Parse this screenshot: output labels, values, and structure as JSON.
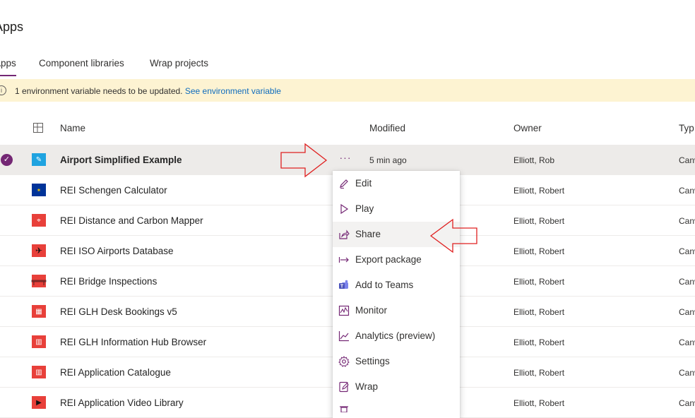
{
  "page": {
    "title": "Apps"
  },
  "tabs": [
    {
      "label": "Apps",
      "active": true
    },
    {
      "label": "Component libraries",
      "active": false
    },
    {
      "label": "Wrap projects",
      "active": false
    }
  ],
  "banner": {
    "message": "1 environment variable needs to be updated. ",
    "link": "See environment variable",
    "icon": "info-icon"
  },
  "table": {
    "headers": {
      "name": "Name",
      "modified": "Modified",
      "owner": "Owner",
      "type": "Typ"
    },
    "rows": [
      {
        "name": "Airport Simplified Example",
        "modified": "5 min ago",
        "owner": "Elliott, Rob",
        "type": "Canv",
        "icon": "pencil-icon",
        "icon_color": "#1fa3e0",
        "selected": true
      },
      {
        "name": "REI Schengen Calculator",
        "modified": "",
        "owner": "Elliott, Robert",
        "type": "Canv",
        "icon": "eu-flag-icon",
        "icon_color": "#003399",
        "selected": false
      },
      {
        "name": "REI Distance and Carbon Mapper",
        "modified": "",
        "owner": "Elliott, Robert",
        "type": "Canv",
        "icon": "map-icon",
        "icon_color": "#e8403a",
        "selected": false
      },
      {
        "name": "REI ISO Airports Database",
        "modified": "",
        "owner": "Elliott, Robert",
        "type": "Canv",
        "icon": "airplane-icon",
        "icon_color": "#e8403a",
        "selected": false
      },
      {
        "name": "REI Bridge Inspections",
        "modified": "",
        "owner": "Elliott, Robert",
        "type": "Canv",
        "icon": "bridge-icon",
        "icon_color": "#e8403a",
        "selected": false
      },
      {
        "name": "REI GLH Desk Bookings v5",
        "modified": "",
        "owner": "Elliott, Robert",
        "type": "Canv",
        "icon": "desk-icon",
        "icon_color": "#e8403a",
        "selected": false
      },
      {
        "name": "REI GLH Information Hub Browser",
        "modified": "",
        "owner": "Elliott, Robert",
        "type": "Canv",
        "icon": "books-icon",
        "icon_color": "#e8403a",
        "selected": false
      },
      {
        "name": "REI Application Catalogue",
        "modified": "",
        "owner": "Elliott, Robert",
        "type": "Canv",
        "icon": "books-icon",
        "icon_color": "#e8403a",
        "selected": false
      },
      {
        "name": "REI Application Video Library",
        "modified": "",
        "owner": "Elliott, Robert",
        "type": "Canv",
        "icon": "video-icon",
        "icon_color": "#e8403a",
        "selected": false
      }
    ]
  },
  "context_menu": {
    "items": [
      {
        "label": "Edit",
        "icon": "edit-icon"
      },
      {
        "label": "Play",
        "icon": "play-icon"
      },
      {
        "label": "Share",
        "icon": "share-icon"
      },
      {
        "label": "Export package",
        "icon": "export-icon"
      },
      {
        "label": "Add to Teams",
        "icon": "teams-icon"
      },
      {
        "label": "Monitor",
        "icon": "monitor-icon"
      },
      {
        "label": "Analytics (preview)",
        "icon": "analytics-icon"
      },
      {
        "label": "Settings",
        "icon": "settings-icon"
      },
      {
        "label": "Wrap",
        "icon": "wrap-icon"
      }
    ]
  },
  "colors": {
    "accent": "#742774",
    "annotation": "#e02020",
    "banner": "#fdf3d2",
    "selected_row": "#edebe9"
  }
}
